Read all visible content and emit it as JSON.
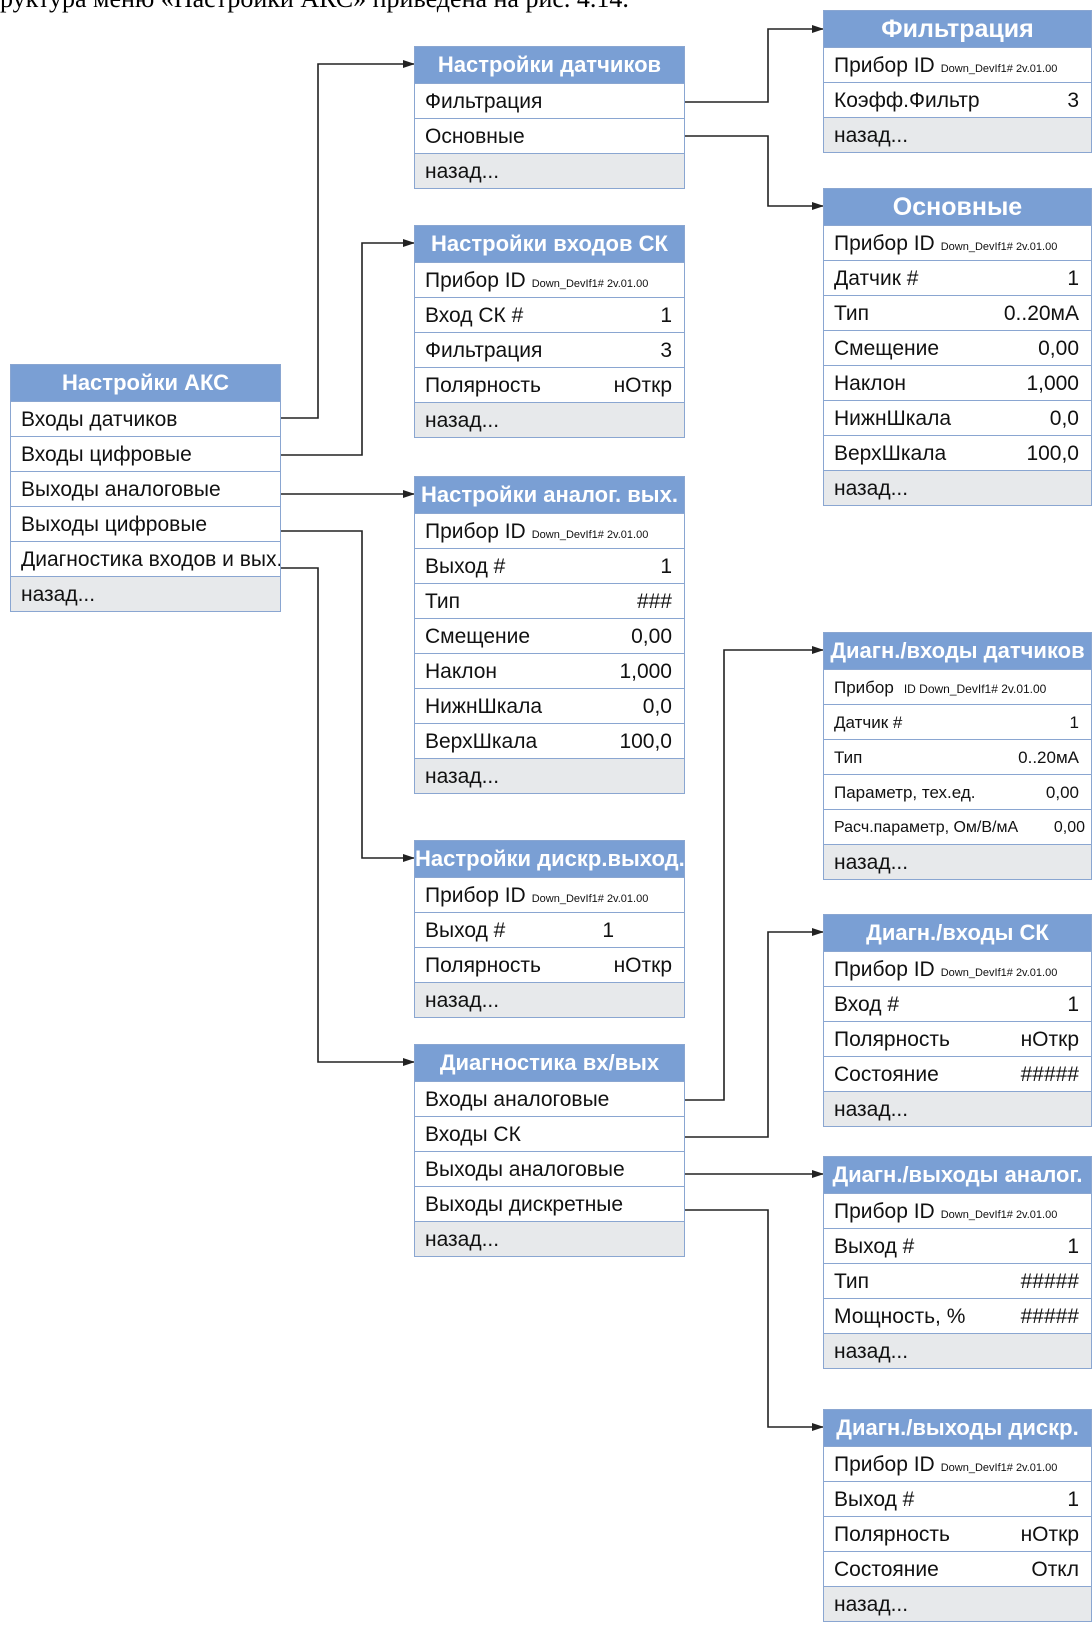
{
  "intro_text": "руктура меню «Настройки АКС» приведена на рис. 4.14.",
  "colors": {
    "header_bg": "#7a9fd4",
    "border": "#8aa6d1",
    "back_row_bg": "#e7e9eb",
    "connector": "#222222"
  },
  "menus": {
    "main": {
      "title": "Настройки АКС",
      "items": [
        "Входы датчиков",
        "Входы цифровые",
        "Выходы аналоговые",
        "Выходы цифровые",
        "Диагностика входов и вых."
      ],
      "back": "назад..."
    },
    "sensors": {
      "title": "Настройки датчиков",
      "items": [
        "Фильтрация",
        "Основные"
      ],
      "back": "назад..."
    },
    "filtration": {
      "title": "Фильтрация",
      "device_label": "Прибор ID",
      "device_id": "Down_DevIf1# 2v.01.00",
      "rows": [
        {
          "label": "Коэфф.Фильтр",
          "value": "3"
        }
      ],
      "back": "назад..."
    },
    "basic": {
      "title": "Основные",
      "device_label": "Прибор ID",
      "device_id": "Down_DevIf1# 2v.01.00",
      "rows": [
        {
          "label": "Датчик #",
          "value": "1"
        },
        {
          "label": "Тип",
          "value": "0..20мА"
        },
        {
          "label": "Смещение",
          "value": "0,00"
        },
        {
          "label": "Наклон",
          "value": "1,000"
        },
        {
          "label": "НижнШкала",
          "value": "0,0"
        },
        {
          "label": "ВерхШкала",
          "value": "100,0"
        }
      ],
      "back": "назад..."
    },
    "sk_inputs": {
      "title": "Настройки входов СК",
      "device_label": "Прибор ID",
      "device_id": "Down_DevIf1# 2v.01.00",
      "rows": [
        {
          "label": "Вход СК #",
          "value": "1"
        },
        {
          "label": "Фильтрация",
          "value": "3"
        },
        {
          "label": "Полярность",
          "value": "нОткр"
        }
      ],
      "back": "назад..."
    },
    "analog_out": {
      "title": "Настройки аналог. вых.",
      "device_label": "Прибор ID",
      "device_id": "Down_DevIf1# 2v.01.00",
      "rows": [
        {
          "label": "Выход #",
          "value": "1"
        },
        {
          "label": "Тип",
          "value": "###"
        },
        {
          "label": "Смещение",
          "value": "0,00"
        },
        {
          "label": "Наклон",
          "value": "1,000"
        },
        {
          "label": "НижнШкала",
          "value": "0,0"
        },
        {
          "label": "ВерхШкала",
          "value": "100,0"
        }
      ],
      "back": "назад..."
    },
    "discrete_out": {
      "title": "Настройки дискр.выход.",
      "device_label": "Прибор ID",
      "device_id": "Down_DevIf1# 2v.01.00",
      "rows": [
        {
          "label": "Выход  #",
          "value": "1"
        },
        {
          "label": "Полярность",
          "value": "нОткр"
        }
      ],
      "back": "назад..."
    },
    "diag": {
      "title": "Диагностика вх/вых",
      "items": [
        "Входы аналоговые",
        "Входы СК",
        "Выходы аналоговые",
        "Выходы дискретные"
      ],
      "back": "назад..."
    },
    "diag_sensors": {
      "title": "Диагн./входы датчиков",
      "device_label": "Прибор",
      "device_id": "ID Down_DevIf1# 2v.01.00",
      "rows": [
        {
          "label": "Датчик #",
          "value": "1"
        },
        {
          "label": "Тип",
          "value": "0..20мА"
        },
        {
          "label": "Параметр, тех.ед.",
          "value": "0,00"
        },
        {
          "label": "Расч.параметр, Ом/В/мА",
          "value": "0,00"
        }
      ],
      "back": "назад..."
    },
    "diag_sk": {
      "title": "Диагн./входы СК",
      "device_label": "Прибор ID",
      "device_id": "Down_DevIf1# 2v.01.00",
      "rows": [
        {
          "label": "Вход #",
          "value": "1"
        },
        {
          "label": "Полярность",
          "value": "нОткр"
        },
        {
          "label": "Состояние",
          "value": "#####"
        }
      ],
      "back": "назад..."
    },
    "diag_analog_out": {
      "title": "Диагн./выходы аналог.",
      "device_label": "Прибор ID",
      "device_id": "Down_DevIf1# 2v.01.00",
      "rows": [
        {
          "label": "Выход #",
          "value": "1"
        },
        {
          "label": "Тип",
          "value": "#####"
        },
        {
          "label": "Мощность, %",
          "value": "#####"
        }
      ],
      "back": "назад..."
    },
    "diag_discrete_out": {
      "title": "Диагн./выходы дискр.",
      "device_label": "Прибор ID",
      "device_id": "Down_DevIf1# 2v.01.00",
      "rows": [
        {
          "label": "Выход #",
          "value": "1"
        },
        {
          "label": "Полярность",
          "value": "нОткр"
        },
        {
          "label": "Состояние",
          "value": "Откл"
        }
      ],
      "back": "назад..."
    }
  }
}
